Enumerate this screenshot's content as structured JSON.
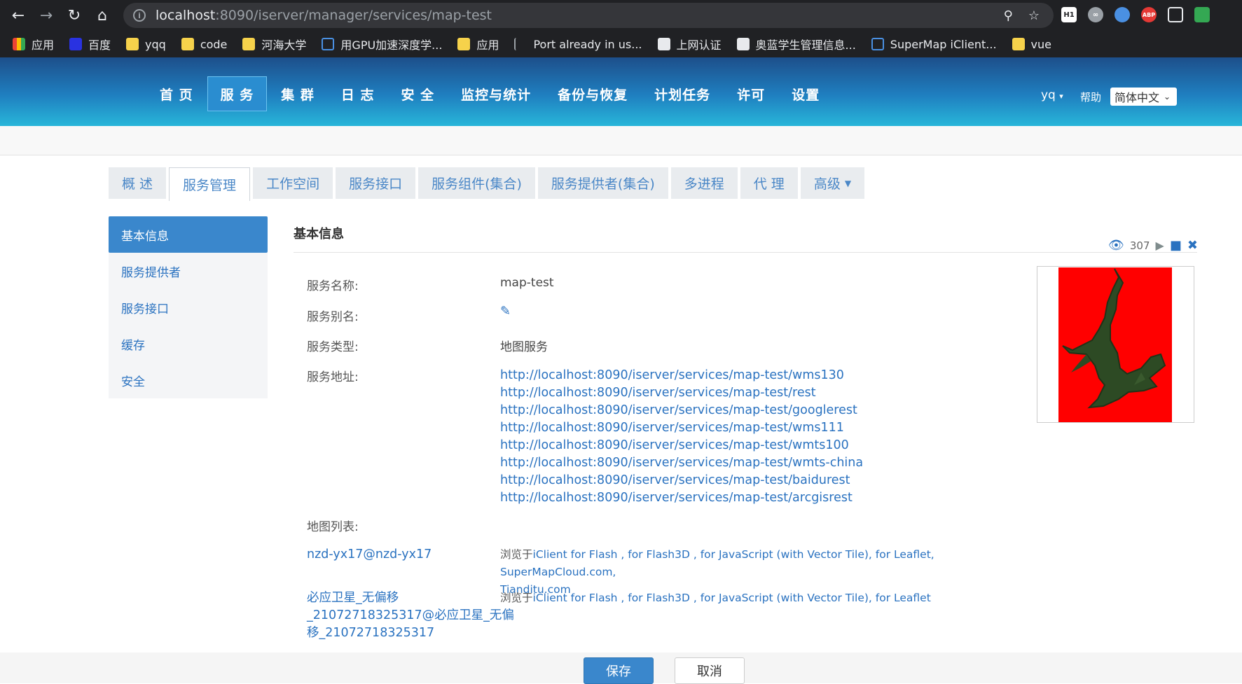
{
  "browser": {
    "url_host": "localhost",
    "url_rest": ":8090/iserver/manager/services/map-test",
    "bookmarks": [
      "应用",
      "百度",
      "yqq",
      "code",
      "河海大学",
      "用GPU加速深度学...",
      "应用",
      "Port already in us...",
      "上网认证",
      "奥蓝学生管理信息...",
      "SuperMap iClient...",
      "vue"
    ]
  },
  "header": {
    "nav": [
      "首 页",
      "服 务",
      "集 群",
      "日 志",
      "安 全",
      "监控与统计",
      "备份与恢复",
      "计划任务",
      "许可",
      "设置"
    ],
    "active_nav": "服 务",
    "user": "yq",
    "help": "帮助",
    "language": "简体中文"
  },
  "tabs": [
    "概 述",
    "服务管理",
    "工作空间",
    "服务接口",
    "服务组件(集合)",
    "服务提供者(集合)",
    "多进程",
    "代 理",
    "高级"
  ],
  "active_tab": "服务管理",
  "left_menu": [
    "基本信息",
    "服务提供者",
    "服务接口",
    "缓存",
    "安全"
  ],
  "main": {
    "section_title": "基本信息",
    "view_count": "307",
    "labels": {
      "name": "服务名称:",
      "alias": "服务别名:",
      "type": "服务类型:",
      "address": "服务地址:",
      "map_list": "地图列表:"
    },
    "values": {
      "name": "map-test",
      "type": "地图服务"
    },
    "urls": [
      "http://localhost:8090/iserver/services/map-test/wms130",
      "http://localhost:8090/iserver/services/map-test/rest",
      "http://localhost:8090/iserver/services/map-test/googlerest",
      "http://localhost:8090/iserver/services/map-test/wms111",
      "http://localhost:8090/iserver/services/map-test/wmts100",
      "http://localhost:8090/iserver/services/map-test/wmts-china",
      "http://localhost:8090/iserver/services/map-test/baidurest",
      "http://localhost:8090/iserver/services/map-test/arcgisrest"
    ],
    "maps": [
      {
        "name": "nzd-yx17@nzd-yx17",
        "browse_prefix": "浏览于",
        "links_line1": "iClient for Flash , for Flash3D , for JavaScript (with Vector Tile), for Leaflet, SuperMapCloud.com,",
        "links_line2": "Tianditu.com"
      },
      {
        "name_line1": "必应卫星_无偏移",
        "name_line2": "_21072718325317@必应卫星_无偏",
        "name_line3": "移_21072718325317",
        "browse_prefix": "浏览于",
        "links_line1": "iClient for Flash , for Flash3D , for JavaScript (with Vector Tile), for Leaflet"
      }
    ]
  },
  "buttons": {
    "save": "保存",
    "cancel": "取消"
  }
}
